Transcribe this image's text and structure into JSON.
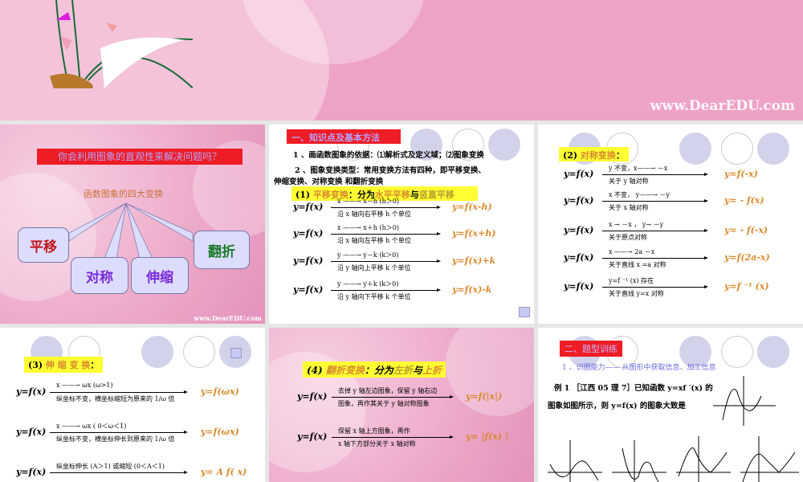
{
  "banner": {
    "watermark": "www.DearEDU.com"
  },
  "slide1": {
    "question": "你会利用图象的直观性来解决问题吗？",
    "subtitle": "函数图象的四大变换",
    "bubbles": [
      "平移",
      "对称",
      "伸缩",
      "翻折"
    ],
    "watermark": "www.DearEDU.com"
  },
  "slide2": {
    "section_title": "一、知识点及基本方法",
    "line1": "1 、画函数图象的依据：⑴解析式及定义域；⑵图象变换",
    "line2": "2 、图象变换类型：常用变换方法有四种，即平移变换、",
    "line3": "伸缩变换、对称变换  和翻折变换",
    "heading": {
      "prefix": "(1) ",
      "name": "平移变换",
      "mid": "：分为",
      "a": "水平平移",
      "and": "与",
      "b": "竖直平移"
    },
    "rows": [
      {
        "lhs": "y=f(x)",
        "above": "x ——→  x－h (h＞0)",
        "below": "沿 x 轴向右平移 h 个单位",
        "rhs": "y=f(x-h)"
      },
      {
        "lhs": "y=f(x)",
        "above": "x ——→  x＋h (h＞0)",
        "below": "沿 x 轴向左平移 h 个单位",
        "rhs": "y=f(x+h)"
      },
      {
        "lhs": "y=f(x)",
        "above": "y ——→ y－k (k＞0)",
        "below": "沿 y 轴向上平移 k 个单位",
        "rhs": "y=f(x)+k"
      },
      {
        "lhs": "y=f(x)",
        "above": "y ——→ y＋k (k＞0)",
        "below": "沿 y 轴向下平移 k 个单位",
        "rhs": "y=f(x)-k"
      }
    ]
  },
  "slide3": {
    "heading": {
      "prefix": "(2) ",
      "name": "对称变换",
      "suffix": "："
    },
    "rows": [
      {
        "lhs": "y=f(x)",
        "above": "y 不变，x——→  －x",
        "below": "关于 y 轴对称",
        "rhs": "y=f(-x)"
      },
      {
        "lhs": "y=f(x)",
        "above": "x 不变， y——→ －y",
        "below": "关于 x 轴对称",
        "rhs": "y= - f(x)"
      },
      {
        "lhs": "y=f(x)",
        "above": "x → －x ， y→ －y",
        "below": "关于原点对称",
        "rhs": "y= - f(-x)"
      },
      {
        "lhs": "y=f(x)",
        "above": "x ——→  2a －x",
        "below": "关于直线 x =a 对称",
        "rhs": "y=f(2a-x)"
      },
      {
        "lhs": "y=f(x)",
        "above": "y=f ⁻¹ (x) 存在",
        "below": "关于直线 y=x 对称",
        "rhs": "y=f ⁻¹ (x)"
      }
    ]
  },
  "slide4": {
    "heading": {
      "prefix": "(3) ",
      "name": "伸 缩 变 换",
      "suffix": "："
    },
    "rows": [
      {
        "lhs": "y=f(x)",
        "above": "x ——→  ωx  (ω>1)",
        "below": "纵坐标不变，横坐标缩短为原来的 1/ω 倍",
        "rhs": "y=f(ωx)"
      },
      {
        "lhs": "y=f(x)",
        "above": "x ——→  ωx  ( 0＜ω＜1)",
        "below": "纵坐标不变，横坐标伸长到原来的 1/ω 倍",
        "rhs": "y=f(ωx)"
      },
      {
        "lhs": "y=f(x)",
        "above": "纵坐标伸长 (A＞1) 或缩短 (0＜A＜1)",
        "below": "",
        "rhs": "y= A f( x)"
      }
    ]
  },
  "slide5": {
    "heading": {
      "prefix": "(4) ",
      "name": "翻折变换",
      "mid": "：分为",
      "a": "左折",
      "and": "与",
      "b": "上折"
    },
    "rows": [
      {
        "lhs": "y=f(x)",
        "above": "去掉 y 轴左边图象，保留 y 轴右边",
        "below": "图象，再作其关于 y 轴对称图象",
        "rhs": "y=f(|x|)"
      },
      {
        "lhs": "y=f(x)",
        "above": "保留 x  轴上方图象，再作",
        "below": "x 轴下方部分关于 x 轴对称",
        "rhs": "y= |f(x) |"
      }
    ]
  },
  "slide6": {
    "section_title": "二、题型训练",
    "subtitle": "1 、识图能力——        从图形中获取信息、加工信息",
    "example_line1": "例 1  ［江西 05 理 7］已知函数 y=xf ′(x) 的",
    "example_line2": "图象如图所示，则 y=f(x) 的图象大致是"
  },
  "colors": {
    "accent_red": "#ee1c24",
    "highlight": "#ffff33",
    "result_orange": "#d98a2c",
    "banner_pink": "#eea3c6"
  }
}
